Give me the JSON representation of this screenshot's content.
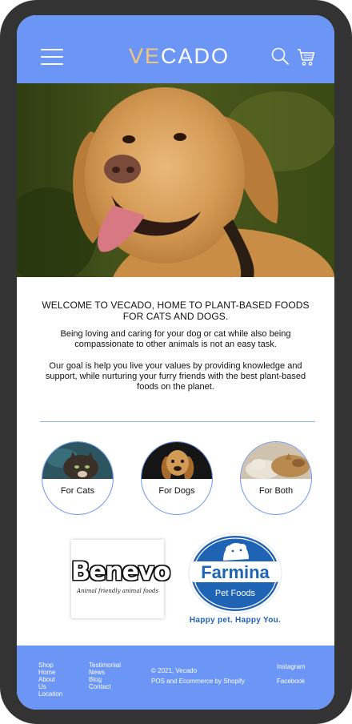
{
  "header": {
    "logo_part1": "VE",
    "logo_part2": "CADO"
  },
  "intro": {
    "heading": "WELCOME TO VECADO, HOME TO PLANT-BASED FOODS FOR CATS AND DOGS.",
    "paragraph1": "Being loving and caring for your dog or cat while also being compassionate to other animals is not an easy task.",
    "paragraph2": "Our goal is help you live your values by providing knowledge and support, while nurturing your furry friends with the best plant-based foods on the planet."
  },
  "categories": [
    {
      "label": "For Cats"
    },
    {
      "label": "For Dogs"
    },
    {
      "label": "For Both"
    }
  ],
  "brands": {
    "benevo": {
      "name": "Benevo",
      "tagline": "Animal friendly animal foods"
    },
    "farmina": {
      "name": "Farmina",
      "sub": "Pet Foods",
      "slogan": "Happy pet. Happy You."
    }
  },
  "footer": {
    "col1": [
      "Shop",
      "Home",
      "About Us",
      "Location"
    ],
    "col2": [
      "Testimonial",
      "News",
      "Blog",
      "Contact"
    ],
    "copyright": "© 2021, Vecado",
    "powered": "POS and Ecommerce by Shopify",
    "social": [
      "Instagram",
      "Facebook"
    ]
  },
  "colors": {
    "brand_blue": "#6b96f5",
    "logo_accent": "#f5c57a",
    "frame": "#333333"
  }
}
